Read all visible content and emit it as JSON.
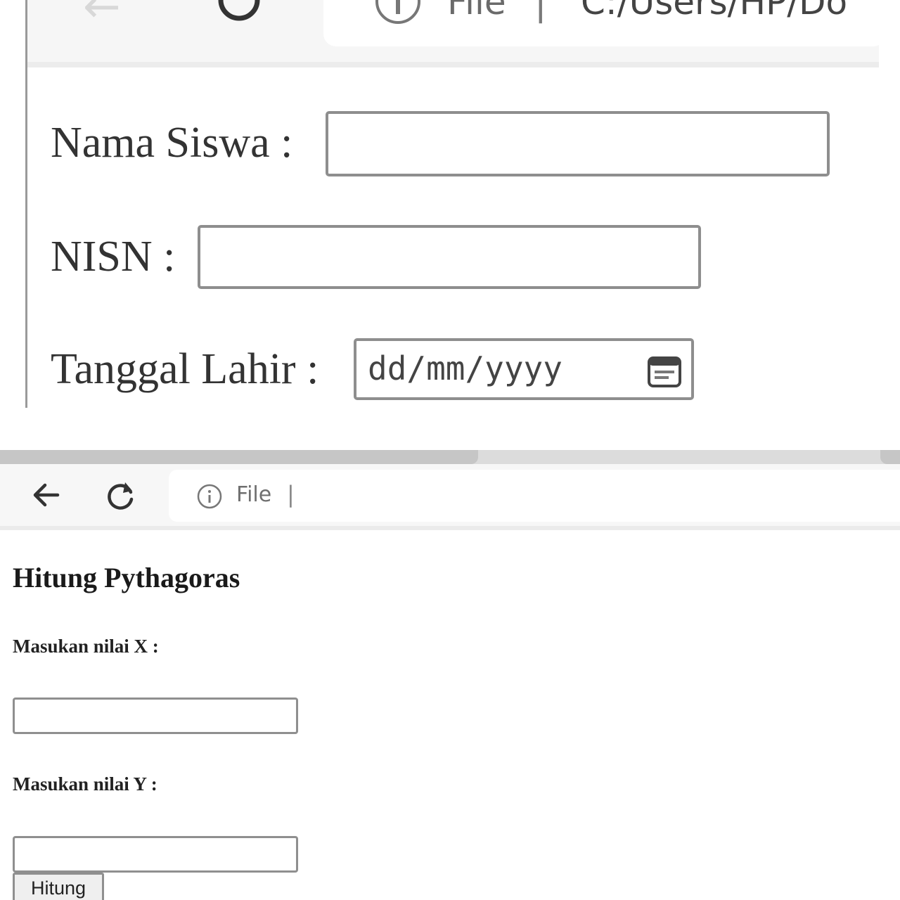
{
  "top_browser": {
    "back_icon": "arrow-left-icon",
    "reload_icon": "reload-icon",
    "info_icon": "info-icon",
    "scheme_label": "File",
    "separator": "|",
    "url": "C:/Users/HP/Do"
  },
  "student_form": {
    "name_label": "Nama Siswa :",
    "nisn_label": "NISN :",
    "dob_label": "Tanggal Lahir :",
    "dob_placeholder": "dd/mm/yyyy",
    "calendar_icon": "calendar-icon"
  },
  "bottom_browser": {
    "back_icon": "arrow-left-icon",
    "reload_icon": "reload-icon",
    "info_icon": "info-icon",
    "scheme_label": "File",
    "separator": "|"
  },
  "pythagoras_form": {
    "heading": "Hitung Pythagoras",
    "x_label": "Masukan nilai X :",
    "y_label": "Masukan nilai Y :",
    "submit_label": "Hitung"
  }
}
